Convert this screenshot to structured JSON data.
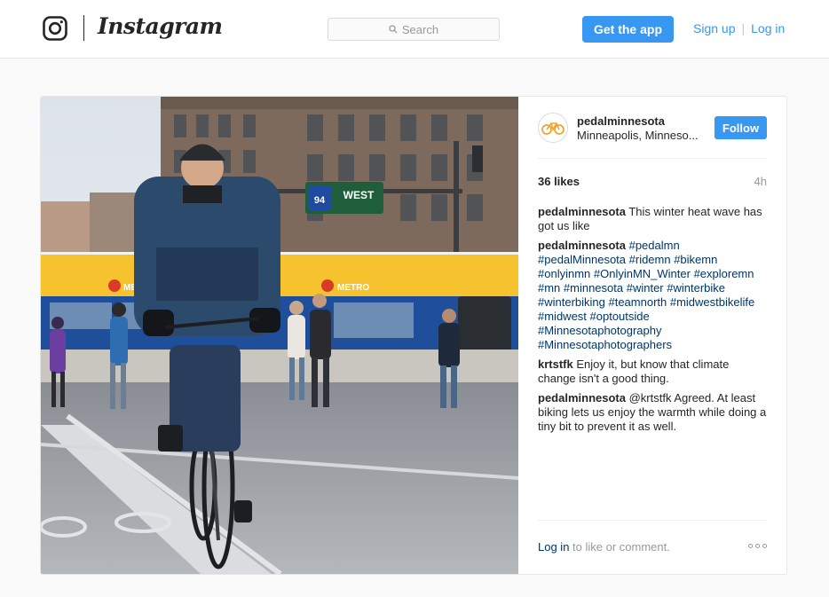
{
  "header": {
    "brand": "Instagram",
    "search_placeholder": "Search",
    "get_app": "Get the app",
    "sign_up": "Sign up",
    "separator": "|",
    "log_in": "Log in",
    "accent_color": "#3897f0"
  },
  "post": {
    "username": "pedalminnesota",
    "location": "Minneapolis, Minneso...",
    "follow": "Follow",
    "likes": "36 likes",
    "age": "4h",
    "photo_sign": "WEST",
    "photo_route": "94",
    "photo_brand": "METRO",
    "comments": [
      {
        "user": "pedalminnesota",
        "text": "This winter heat wave has got us like"
      },
      {
        "user": "pedalminnesota",
        "text": "#pedalmn #pedalMinnesota #ridemn #bikemn #onlyinmn #OnlyinMN_Winter #exploremn #mn #minnesota #winter #winterbike #winterbiking #teamnorth #midwestbikelife #midwest #optoutside #Minnesotaphotography #Minnesotaphotographers"
      },
      {
        "user": "krtstfk",
        "text": "Enjoy it, but know that climate change isn't a good thing."
      },
      {
        "user": "pedalminnesota",
        "text": "@krtstfk Agreed. At least biking lets us enjoy the warmth while doing a tiny bit to prevent it as well."
      }
    ],
    "footer_login": "Log in",
    "footer_rest": " to like or comment."
  }
}
